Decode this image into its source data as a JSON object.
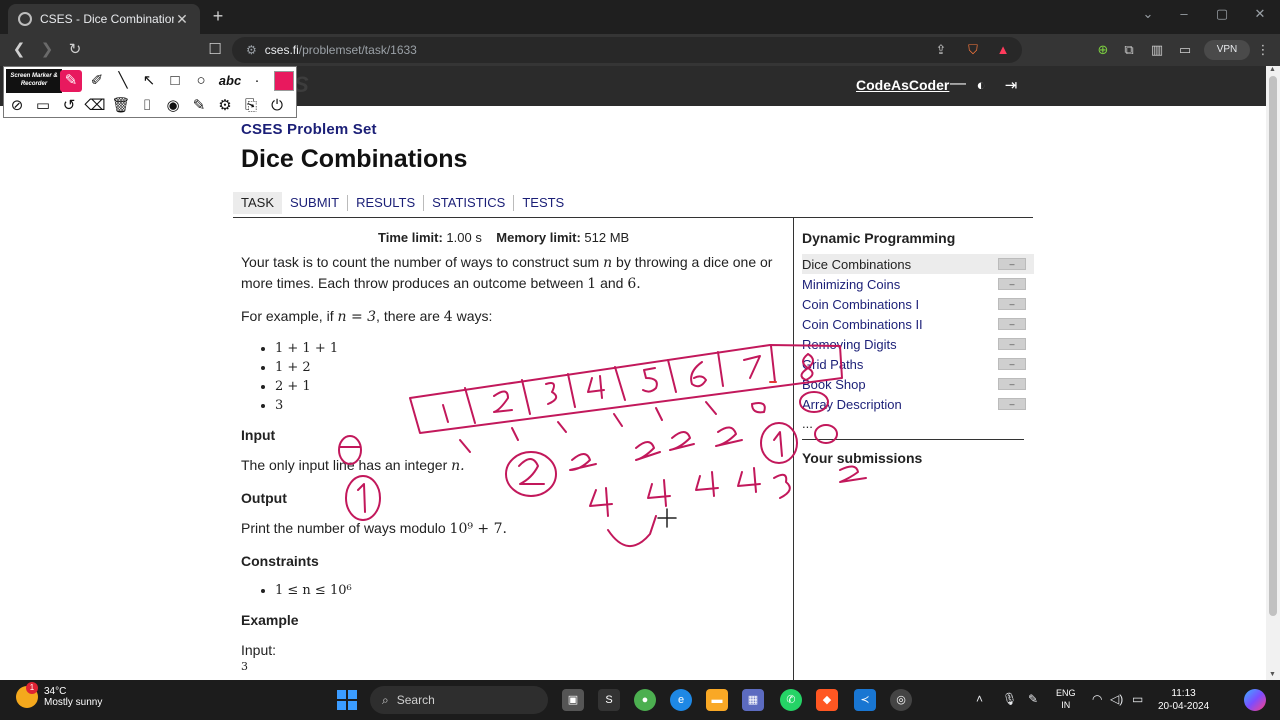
{
  "browser": {
    "tab_title": "CSES - Dice Combinations",
    "url_host": "cses.fi",
    "url_path": "/problemset/task/1633",
    "vpn_label": "VPN"
  },
  "site": {
    "logo": "S",
    "username": "CodeAsCoder",
    "dash": "—"
  },
  "problem": {
    "breadcrumb": "CSES Problem Set",
    "title": "Dice Combinations",
    "tabs": [
      "TASK",
      "SUBMIT",
      "RESULTS",
      "STATISTICS",
      "TESTS"
    ],
    "time_limit_label": "Time limit:",
    "time_limit_value": "1.00 s",
    "memory_limit_label": "Memory limit:",
    "memory_limit_value": "512 MB",
    "statement_1": "Your task is to count the number of ways to construct sum",
    "statement_var": "n",
    "statement_2": "by throwing a dice one or more times. Each throw produces an outcome between",
    "statement_lo": "1",
    "statement_and": "and",
    "statement_hi": "6.",
    "example_1": "For example, if",
    "example_eq": "n = 3",
    "example_2": ", there are",
    "example_count": "4",
    "example_3": "ways:",
    "ways": [
      "1 + 1 + 1",
      "1 + 2",
      "2 + 1",
      "3"
    ],
    "input_heading": "Input",
    "input_text": "The only input line has an integer",
    "input_var": "n.",
    "output_heading": "Output",
    "output_text": "Print the number of ways modulo",
    "output_mod": "10⁹ + 7.",
    "constraints_heading": "Constraints",
    "constraint": "1 ≤ n ≤ 10⁶",
    "example_heading": "Example",
    "example_input_label": "Input:",
    "example_input_value": "3"
  },
  "sidebar": {
    "section_title": "Dynamic Programming",
    "items": [
      {
        "label": "Dice Combinations",
        "status": "–"
      },
      {
        "label": "Minimizing Coins",
        "status": "–"
      },
      {
        "label": "Coin Combinations I",
        "status": "–"
      },
      {
        "label": "Coin Combinations II",
        "status": "–"
      },
      {
        "label": "Removing Digits",
        "status": "–"
      },
      {
        "label": "Grid Paths",
        "status": "–"
      },
      {
        "label": "Book Shop",
        "status": "–"
      },
      {
        "label": "Array Description",
        "status": "–"
      }
    ],
    "more": "...",
    "submissions_title": "Your submissions"
  },
  "marker_toolbar": {
    "brand": "Screen Marker & Recorder",
    "text_tool": "abc",
    "active_color": "#e8195e"
  },
  "taskbar": {
    "temperature": "34°C",
    "weather": "Mostly sunny",
    "weather_badge": "1",
    "search_placeholder": "Search",
    "lang_1": "ENG",
    "lang_2": "IN",
    "time": "11:13",
    "date": "20-04-2024"
  }
}
